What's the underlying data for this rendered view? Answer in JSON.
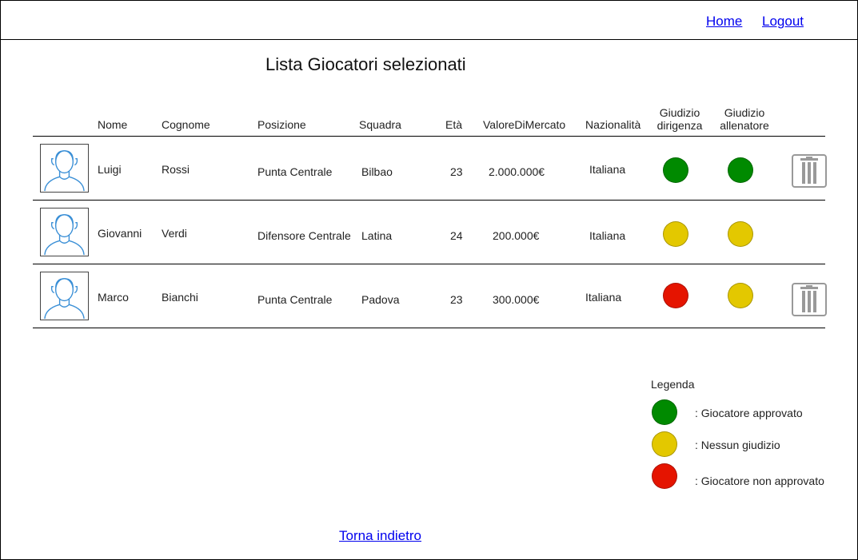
{
  "nav": {
    "home": "Home",
    "logout": "Logout"
  },
  "page": {
    "title": "Lista Giocatori selezionati",
    "back": "Torna indietro"
  },
  "columns": {
    "nome": "Nome",
    "cognome": "Cognome",
    "posizione": "Posizione",
    "squadra": "Squadra",
    "eta": "Età",
    "valore": "ValoreDiMercato",
    "nazionalita": "Nazionalità",
    "giudizio_dirigenza": [
      "Giudizio",
      "dirigenza"
    ],
    "giudizio_allenatore": [
      "Giudizio",
      "allenatore"
    ]
  },
  "players": [
    {
      "nome": "Luigi",
      "cognome": "Rossi",
      "posizione": "Punta Centrale",
      "squadra": "Bilbao",
      "eta": "23",
      "valore": "2.000.000€",
      "nazionalita": "Italiana",
      "giudizio_dirigenza": "approvato",
      "giudizio_allenatore": "approvato",
      "deletable": true
    },
    {
      "nome": "Giovanni",
      "cognome": "Verdi",
      "posizione": "Difensore Centrale",
      "squadra": "Latina",
      "eta": "24",
      "valore": "200.000€",
      "nazionalita": "Italiana",
      "giudizio_dirigenza": "nessuno",
      "giudizio_allenatore": "nessuno",
      "deletable": false
    },
    {
      "nome": "Marco",
      "cognome": "Bianchi",
      "posizione": "Punta Centrale",
      "squadra": "Padova",
      "eta": "23",
      "valore": "300.000€",
      "nazionalita": "Italiana",
      "giudizio_dirigenza": "non_approvato",
      "giudizio_allenatore": "nessuno",
      "deletable": true
    }
  ],
  "legend": {
    "title": "Legenda",
    "items": [
      {
        "key": "approvato",
        "text": ": Giocatore approvato"
      },
      {
        "key": "nessuno",
        "text": ": Nessun giudizio"
      },
      {
        "key": "non_approvato",
        "text": ": Giocatore non approvato"
      }
    ]
  },
  "colors": {
    "approvato": "#008a00",
    "nessuno": "#e3c800",
    "non_approvato": "#e51400",
    "link": "#0000ee",
    "avatar_stroke": "#3a8fd6",
    "trash": "#999999"
  },
  "icons": {
    "avatar": "user-avatar-icon",
    "trash": "trash-icon"
  }
}
